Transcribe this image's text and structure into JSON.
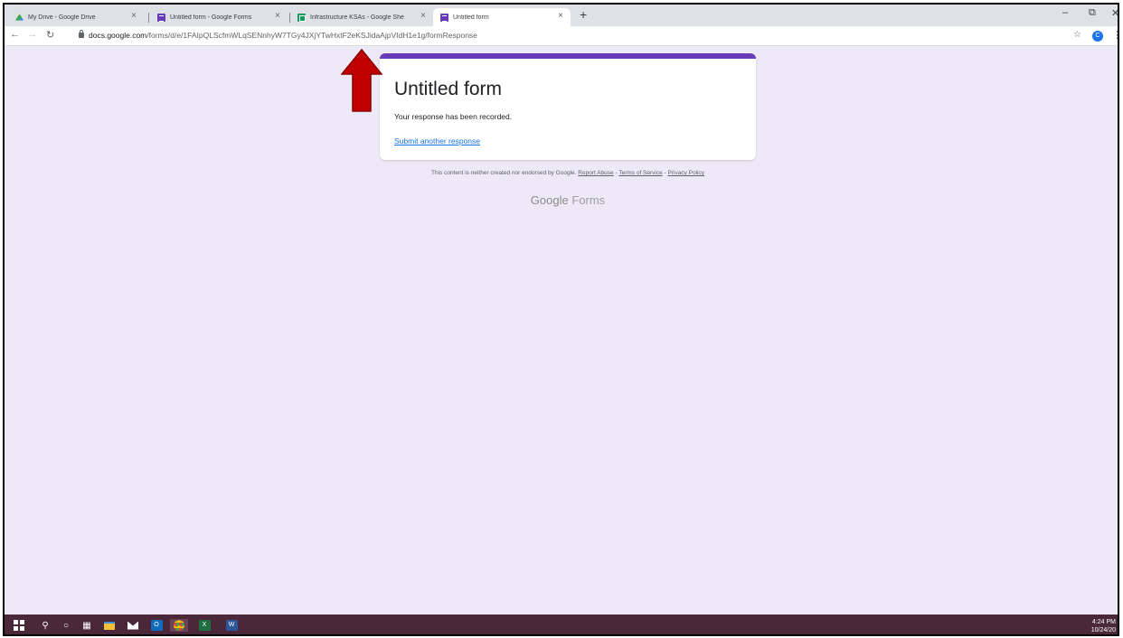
{
  "browser": {
    "tabs": [
      {
        "title": "My Drive - Google Drive",
        "icon": "google-drive-icon"
      },
      {
        "title": "Untitled form - Google Forms",
        "icon": "google-forms-icon"
      },
      {
        "title": "Infrastructure KSAs - Google She",
        "icon": "google-sheets-icon"
      },
      {
        "title": "Untitled form",
        "icon": "google-forms-icon",
        "active": true
      }
    ],
    "tab_close_glyph": "×",
    "new_tab_glyph": "+",
    "url_host": "docs.google.com",
    "url_path": "/forms/d/e/1FAIpQLScfmWLqSENnhyW7TGy4JXjYTwHxtF2eKSJidaAjpVIdH1e1g/formResponse",
    "profile_initial": "C"
  },
  "form": {
    "title": "Untitled form",
    "confirmation": "Your response has been recorded.",
    "another_link": "Submit another response",
    "accent_color": "#673ab7",
    "background_color": "#ede9f6"
  },
  "footer": {
    "note": "This content is neither created nor endorsed by Google.",
    "report_abuse": "Report Abuse",
    "terms": "Terms of Service",
    "privacy": "Privacy Policy",
    "separator": " - ",
    "brand_google": "Google",
    "brand_forms": "Forms"
  },
  "annotation": {
    "type": "red-arrow-pointing-up",
    "color": "#c00000"
  },
  "taskbar": {
    "items": [
      "windows-start-icon",
      "search-icon",
      "cortana-icon",
      "task-view-icon",
      "file-explorer-icon",
      "mail-icon",
      "outlook-icon",
      "chrome-icon",
      "excel-icon",
      "word-icon"
    ],
    "time": "4:24 PM",
    "date": "10/24/20"
  }
}
